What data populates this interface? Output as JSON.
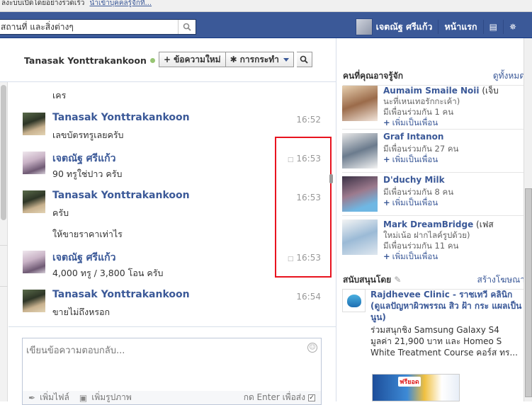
{
  "notice": {
    "text": "ลงะบบเปิดโดยอย่างรวดเร็ว",
    "link": "นำเข้าบุคคลรู้จักที่..."
  },
  "header": {
    "search_placeholder": "สถานที่ และสิ่งต่างๆ",
    "user_name": "เจตณัฐ ศรีแก้ว",
    "home_label": "หน้าแรก"
  },
  "chat": {
    "contact_name": "Tanasak Yonttrakankoon",
    "new_message_label": "ข้อความใหม่",
    "actions_label": "การกระทำ"
  },
  "messages": [
    {
      "text": "เคร"
    },
    {
      "name": "Tanasak Yonttrakankoon",
      "time": "16:52",
      "text": "เลขบัตรทรูเลยครับ"
    },
    {
      "name": "เจตณัฐ ศรีแก้ว",
      "time": "16:53",
      "text": "90 ทรูใช่ปาว ครับ"
    },
    {
      "name": "Tanasak Yonttrakankoon",
      "time": "16:53",
      "text": "ครับ",
      "text2": "ให้ขายราคาเท่าไร"
    },
    {
      "name": "เจตณัฐ ศรีแก้ว",
      "time": "16:53",
      "text": "4,000 ทรู / 3,800 โอน ครับ"
    },
    {
      "name": "Tanasak Yonttrakankoon",
      "time": "16:54",
      "text": "ขายไม่ถึงหรอก"
    }
  ],
  "composer": {
    "placeholder": "เขียนข้อความตอบกลับ...",
    "attach_file": "เพิ่มไฟล์",
    "add_photo": "เพิ่มรูปภาพ",
    "enter_send": "กด Enter เพื่อส่ง"
  },
  "pymk": {
    "heading": "คนที่คุณอาจรู้จัก",
    "see_all": "ดูทั้งหมด",
    "add_label": "เพิ่มเป็นเพื่อน",
    "people": [
      {
        "name": "Aumaim Smaile Noii",
        "rest": " (เจ็บ",
        "line2": "นะที่เหนเทอรักกะเค้า)",
        "mutual": "มีเพื่อนร่วมกัน 1 คน"
      },
      {
        "name": "Graf Intanon",
        "mutual": "มีเพื่อนร่วมกัน 27 คน"
      },
      {
        "name": "D'duchy Milk",
        "mutual": "มีเพื่อนร่วมกัน 8 คน"
      },
      {
        "name": "Mark DreamBridge",
        "rest": " (เฟส",
        "line2": "ใหม่เน้อ ฝากไลค์รูปด้วย)",
        "mutual": "มีเพื่อนร่วมกัน 11 คน"
      }
    ]
  },
  "sponsored": {
    "heading": "สนับสนุนโดย",
    "create_ad": "สร้างโฆษณา",
    "title": "Rajdhevee Clinic - ราชเทวี คลินิก (ดูแลปัญหาผิวพรรณ สิว ฝ้า กระ แผลเป็นนูน)",
    "body": "ร่วมสนุกชิง Samsung Galaxy S4 มูลค่า 21,900 บาท และ Homeo S White Treatment Course คอร์ส ทร...",
    "image_tag": "ฟรียอด"
  }
}
